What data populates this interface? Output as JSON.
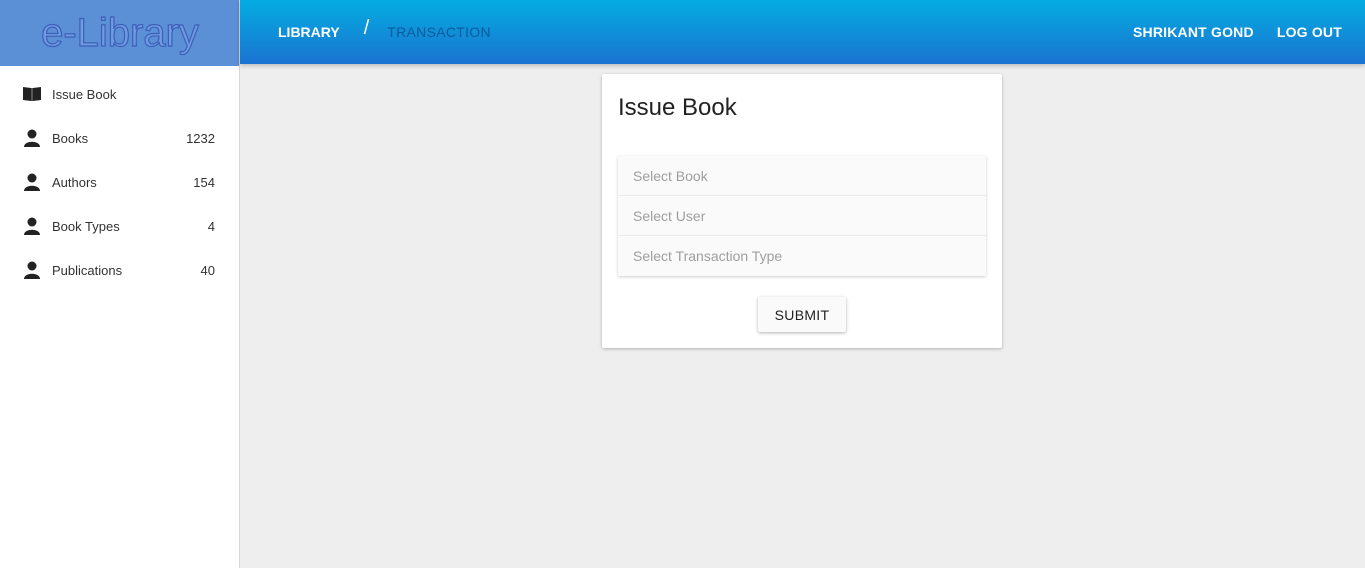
{
  "app": {
    "logo_text": "e-Library"
  },
  "header": {
    "breadcrumb_root": "LIBRARY",
    "breadcrumb_separator": "/",
    "breadcrumb_current": "TRANSACTION",
    "user_name": "SHRIKANT GOND",
    "logout_label": "LOG OUT"
  },
  "sidebar": {
    "items": [
      {
        "label": "Issue Book",
        "count": "",
        "icon": "book-open-icon"
      },
      {
        "label": "Books",
        "count": "1232",
        "icon": "person-icon"
      },
      {
        "label": "Authors",
        "count": "154",
        "icon": "person-icon"
      },
      {
        "label": "Book Types",
        "count": "4",
        "icon": "person-icon"
      },
      {
        "label": "Publications",
        "count": "40",
        "icon": "person-icon"
      }
    ]
  },
  "form": {
    "title": "Issue Book",
    "fields": [
      {
        "placeholder": "Select Book"
      },
      {
        "placeholder": "Select User"
      },
      {
        "placeholder": "Select Transaction Type"
      }
    ],
    "submit_label": "SUBMIT"
  },
  "colors": {
    "header_gradient_top": "#04ade2",
    "header_gradient_bottom": "#1a73d0",
    "logo_bg": "#5b8fd6",
    "page_bg": "#eeeeee"
  }
}
